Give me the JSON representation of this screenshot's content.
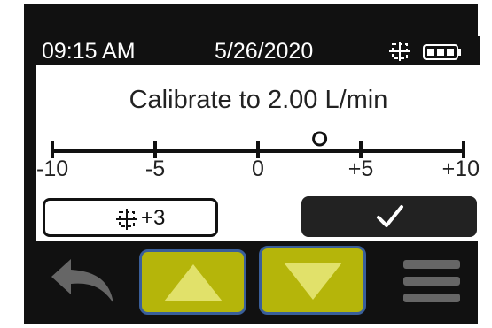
{
  "status_bar": {
    "time": "09:15 AM",
    "date": "5/26/2020",
    "target_icon": "target-crosshair-icon",
    "battery_icon": "battery-icon"
  },
  "screen": {
    "title": "Calibrate to 2.00 L/min",
    "scale": {
      "tick_labels": [
        "-10",
        "-5",
        "0",
        "+5",
        "+10"
      ],
      "min": -10,
      "max": 10,
      "current_value": 3
    },
    "offset_button": {
      "icon": "target-crosshair-icon",
      "value": "+3"
    },
    "confirm_button": {
      "icon": "checkmark-icon"
    }
  },
  "hardware_buttons": {
    "back": "back-arrow-icon",
    "up": "up-triangle-icon",
    "down": "down-triangle-icon",
    "menu": "menu-icon"
  },
  "colors": {
    "accent_yellow": "#b5b50a",
    "button_border": "#3a5f9a",
    "screen_bg": "#ffffff",
    "bezel": "#111111"
  }
}
